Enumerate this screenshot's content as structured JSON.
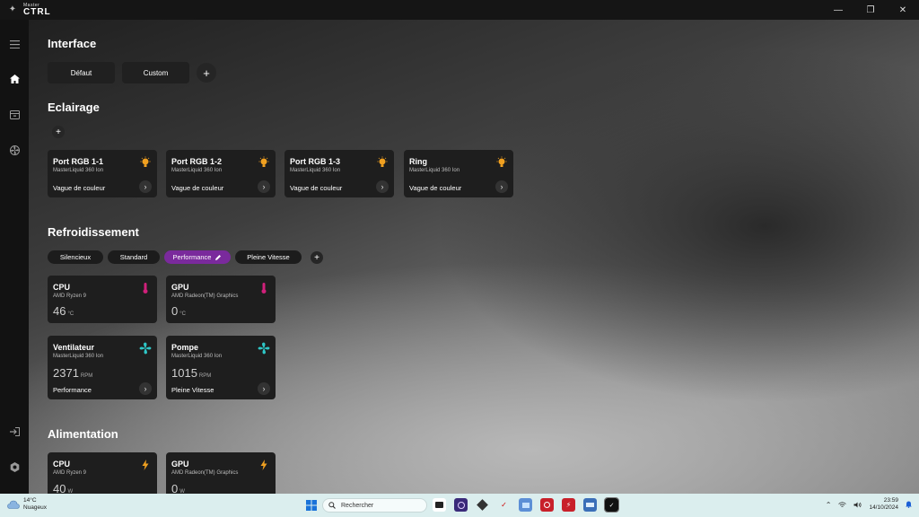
{
  "app": {
    "logo_small": "Master",
    "logo_big": "CTRL"
  },
  "window_controls": {
    "minimize": "—",
    "maximize": "❐",
    "close": "✕"
  },
  "interface": {
    "title": "Interface",
    "buttons": [
      "Défaut",
      "Custom"
    ],
    "add": "+"
  },
  "eclairage": {
    "title": "Eclairage",
    "add": "+",
    "cards": [
      {
        "title": "Port RGB 1-1",
        "sub": "MasterLiquid 360 Ion",
        "effect": "Vague de couleur"
      },
      {
        "title": "Port RGB 1-2",
        "sub": "MasterLiquid 360 Ion",
        "effect": "Vague de couleur"
      },
      {
        "title": "Port RGB 1-3",
        "sub": "MasterLiquid 360 Ion",
        "effect": "Vague de couleur"
      },
      {
        "title": "Ring",
        "sub": "MasterLiquid 360 Ion",
        "effect": "Vague de couleur"
      }
    ]
  },
  "refroidissement": {
    "title": "Refroidissement",
    "modes": [
      "Silencieux",
      "Standard",
      "Performance",
      "Pleine Vitesse"
    ],
    "active_mode": "Performance",
    "add": "+",
    "temps": [
      {
        "title": "CPU",
        "sub": "AMD Ryzen 9",
        "value": "46",
        "unit": "°C"
      },
      {
        "title": "GPU",
        "sub": "AMD Radeon(TM) Graphics",
        "value": "0",
        "unit": "°C"
      }
    ],
    "fans": [
      {
        "title": "Ventilateur",
        "sub": "MasterLiquid 360 Ion",
        "value": "2371",
        "unit": "RPM",
        "mode": "Performance"
      },
      {
        "title": "Pompe",
        "sub": "MasterLiquid 360 Ion",
        "value": "1015",
        "unit": "RPM",
        "mode": "Pleine Vitesse"
      }
    ]
  },
  "alimentation": {
    "title": "Alimentation",
    "cards": [
      {
        "title": "CPU",
        "sub": "AMD Ryzen 9",
        "value": "40",
        "unit": "W"
      },
      {
        "title": "GPU",
        "sub": "AMD Radeon(TM) Graphics",
        "value": "0",
        "unit": "W"
      }
    ]
  },
  "colors": {
    "accent_purple": "#7a2a9c",
    "bulb": "#f0a020",
    "thermo": "#d0207a",
    "fan": "#2ec6c6",
    "bolt": "#f0a020"
  },
  "taskbar": {
    "weather_temp": "14°C",
    "weather_desc": "Nuageux",
    "search_placeholder": "Rechercher",
    "time": "23:59",
    "date": "14/10/2024"
  }
}
